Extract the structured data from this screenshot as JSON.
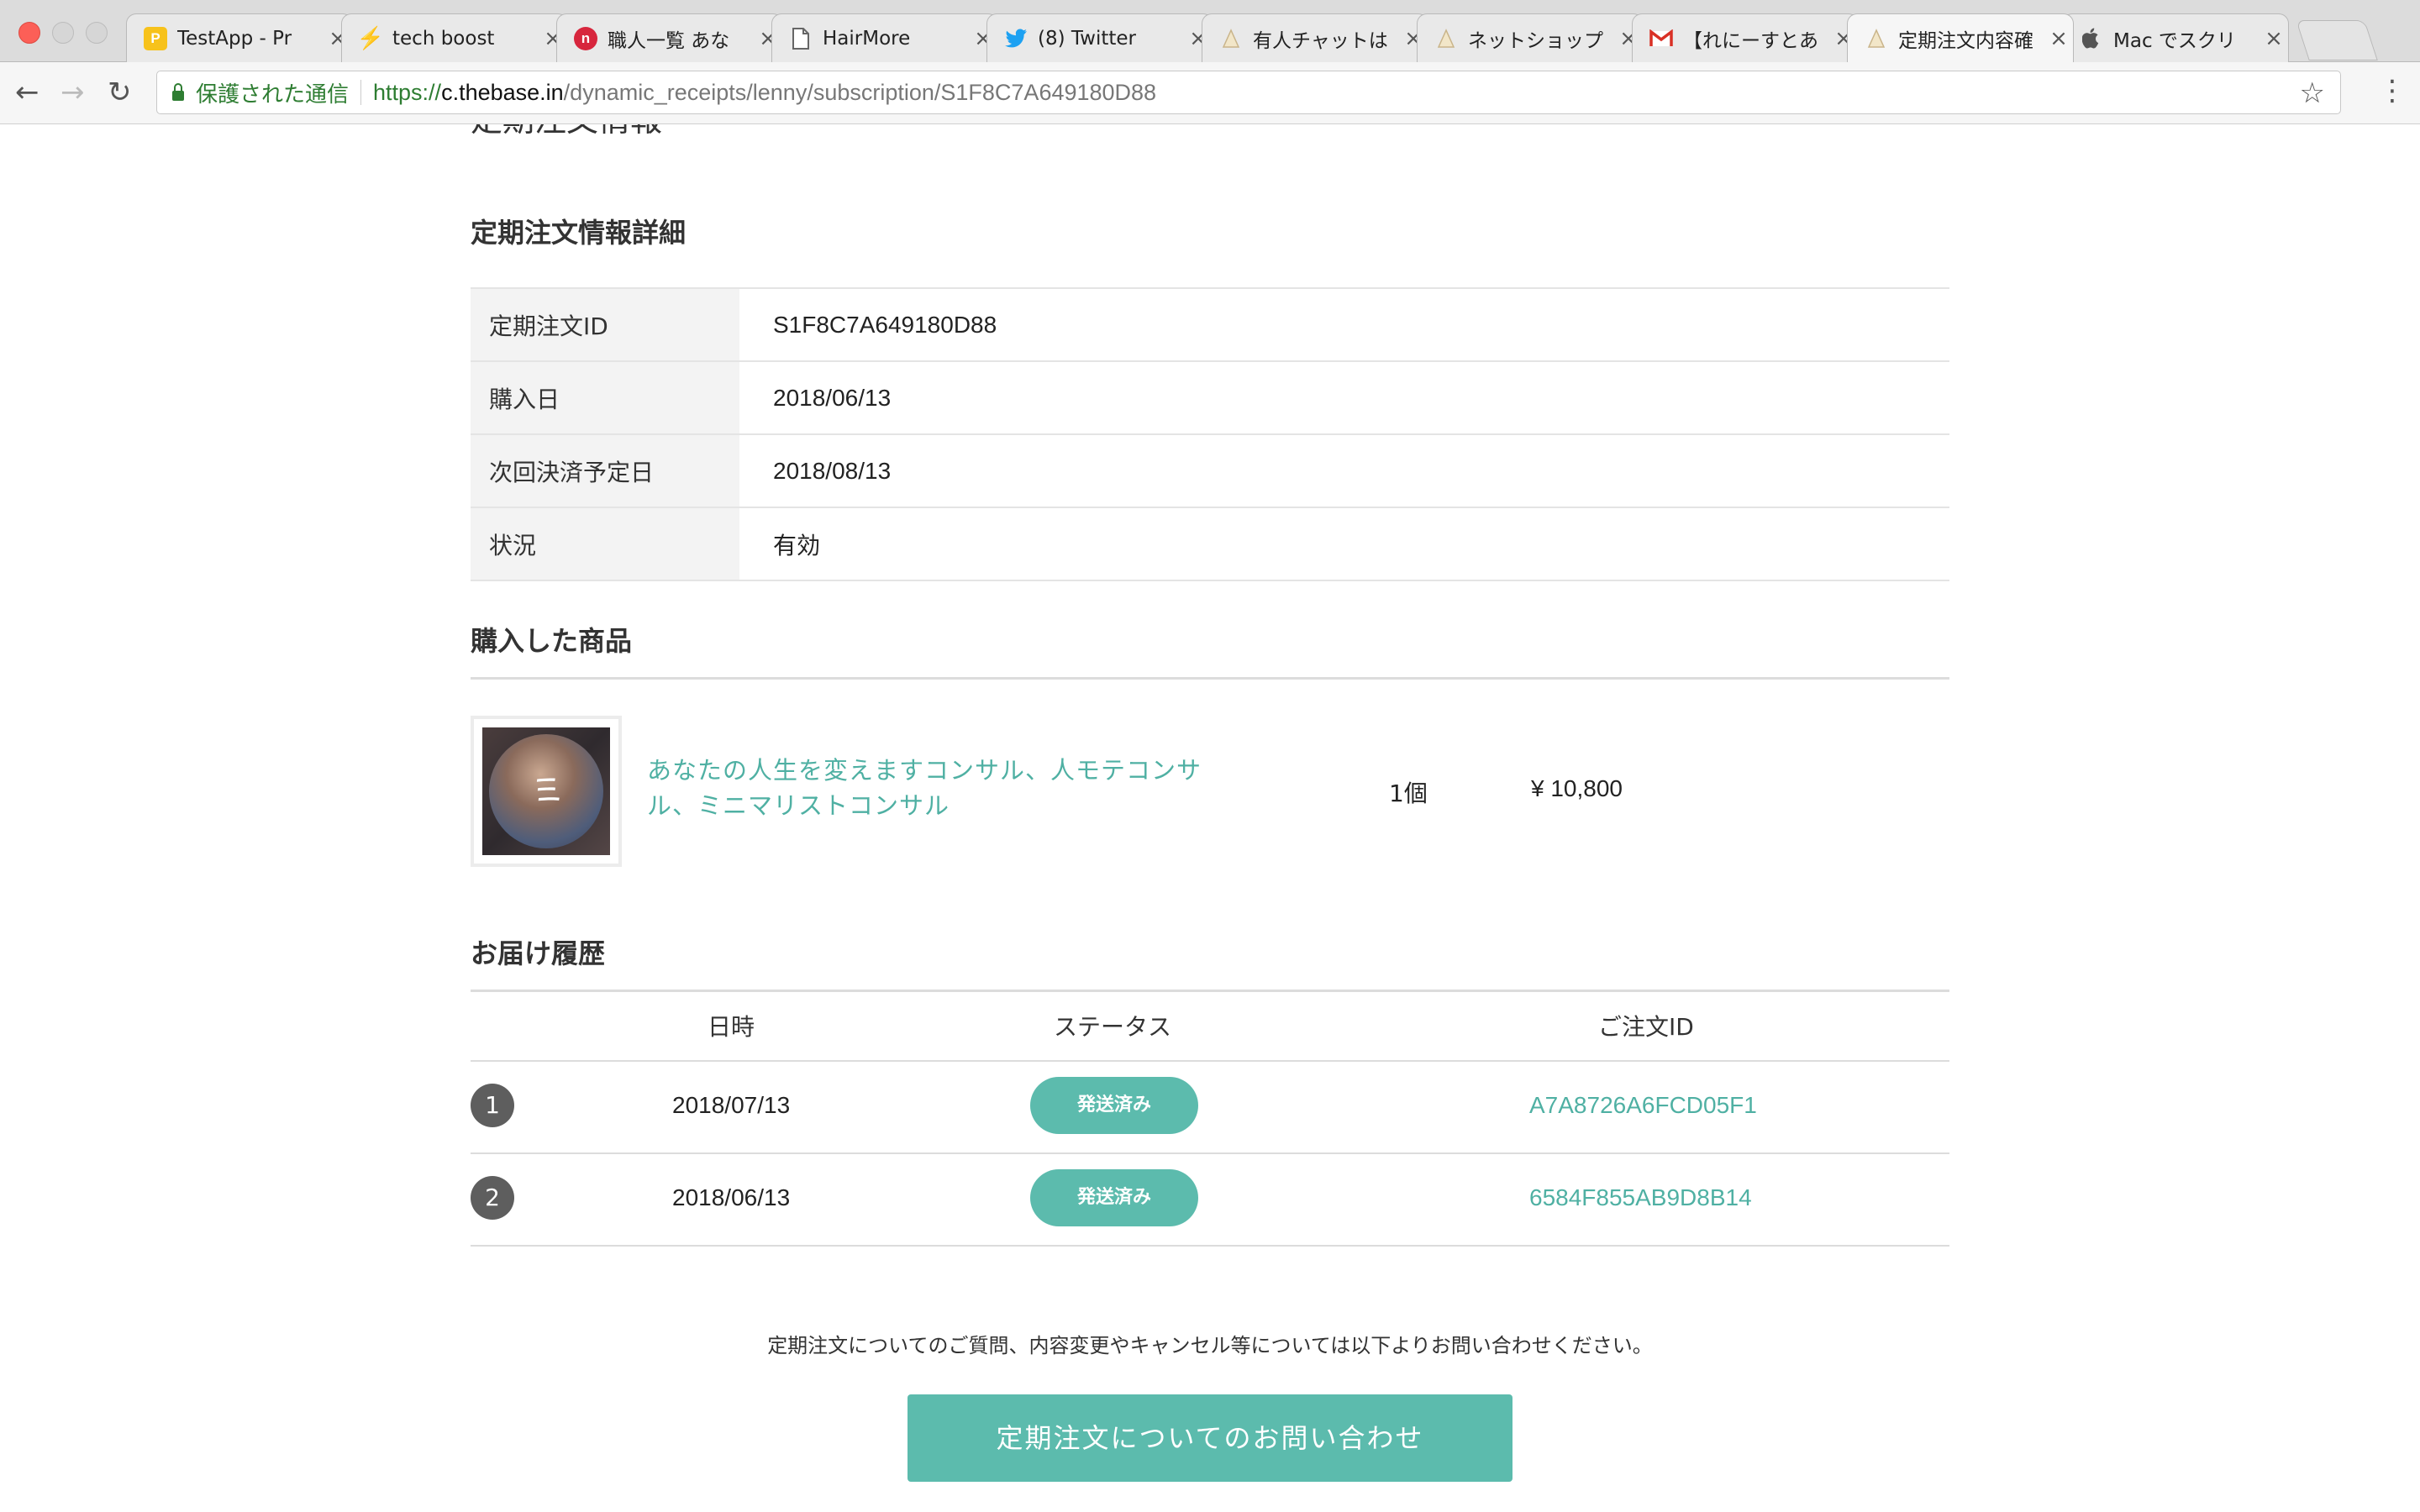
{
  "browser": {
    "tabs": [
      {
        "title": "TestApp - Pr",
        "favicon": "yellow-p-icon",
        "active": false
      },
      {
        "title": "tech boost",
        "favicon": "bolt-icon",
        "active": false
      },
      {
        "title": "職人一覧 あな",
        "favicon": "red-n-icon",
        "active": false
      },
      {
        "title": "HairMore",
        "favicon": "document-icon",
        "active": false
      },
      {
        "title": "(8) Twitter",
        "favicon": "twitter-bird-icon",
        "active": false
      },
      {
        "title": "有人チャットは",
        "favicon": "base-logo-icon",
        "active": false
      },
      {
        "title": "ネットショップ",
        "favicon": "base-logo-icon",
        "active": false
      },
      {
        "title": "【れにーすとあ",
        "favicon": "gmail-icon",
        "active": false
      },
      {
        "title": "定期注文内容確",
        "favicon": "base-logo-icon",
        "active": true
      },
      {
        "title": "Mac でスクリ",
        "favicon": "apple-icon",
        "active": false
      }
    ],
    "secure_label": "保護された通信",
    "url_scheme": "https://",
    "url_host": "c.thebase.in",
    "url_path": "/dynamic_receipts/lenny/subscription/S1F8C7A649180D88"
  },
  "page": {
    "cut_heading": "定期注文情報",
    "details_title": "定期注文情報詳細",
    "details": [
      {
        "label": "定期注文ID",
        "value": "S1F8C7A649180D88"
      },
      {
        "label": "購入日",
        "value": "2018/06/13"
      },
      {
        "label": "次回決済予定日",
        "value": "2018/08/13"
      },
      {
        "label": "状況",
        "value": "有効"
      }
    ],
    "products_title": "購入した商品",
    "product": {
      "name": "あなたの人生を変えますコンサル、人モテコンサル、ミニマリストコンサル",
      "quantity": "1個",
      "price": "¥ 10,800"
    },
    "history_title": "お届け履歴",
    "history_headers": {
      "date": "日時",
      "status": "ステータス",
      "order_id": "ご注文ID"
    },
    "history": [
      {
        "num": "1",
        "date": "2018/07/13",
        "status": "発送済み",
        "order_id": "A7A8726A6FCD05F1"
      },
      {
        "num": "2",
        "date": "2018/06/13",
        "status": "発送済み",
        "order_id": "6584F855AB9D8B14"
      }
    ],
    "inquiry_note": "定期注文についてのご質問、内容変更やキャンセル等については以下よりお問い合わせください。",
    "inquiry_button": "定期注文についてのお問い合わせ"
  },
  "colors": {
    "accent": "#5cbbad",
    "link": "#4fb0a3",
    "secure": "#2e7d32"
  }
}
